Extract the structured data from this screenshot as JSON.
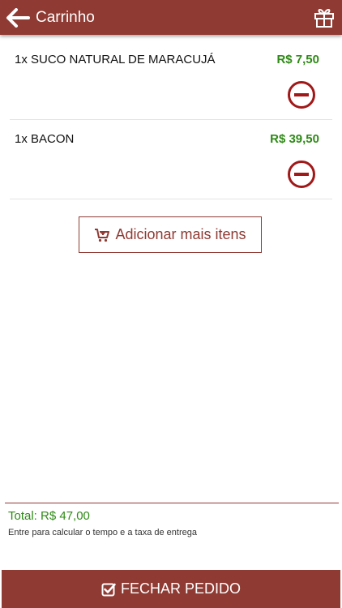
{
  "header": {
    "title": "Carrinho",
    "back_icon": "arrow-left-icon",
    "gift_icon": "gift-icon"
  },
  "cart": {
    "items": [
      {
        "label": "1x SUCO NATURAL DE MARACUJÁ",
        "price": "R$ 7,50"
      },
      {
        "label": "1x BACON",
        "price": "R$ 39,50"
      }
    ],
    "remove_icon": "remove-circle-icon"
  },
  "add_more": {
    "label": "Adicionar mais itens",
    "icon": "cart-plus-icon"
  },
  "summary": {
    "total": "Total: R$ 47,00",
    "note": "Entre para calcular o tempo e a taxa de entrega"
  },
  "checkout": {
    "label": "FECHAR PEDIDO",
    "icon": "check-square-icon"
  },
  "colors": {
    "brand": "#8f3a33",
    "price": "#2e8a16"
  }
}
